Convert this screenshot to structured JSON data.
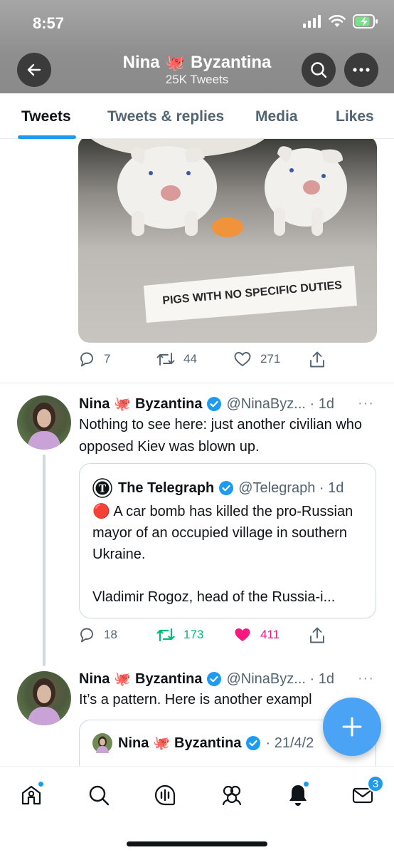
{
  "status_bar": {
    "time": "8:57"
  },
  "header": {
    "name_part1": "Nina",
    "name_emoji": "🐙",
    "name_part2": "Byzantina",
    "tweet_count": "25K Tweets"
  },
  "tabs": [
    {
      "label": "Tweets"
    },
    {
      "label": "Tweets & replies"
    },
    {
      "label": "Media"
    },
    {
      "label": "Likes"
    }
  ],
  "tweet1": {
    "image_sign": "PIGS WITH NO SPECIFIC DUTIES",
    "replies": "7",
    "retweets": "44",
    "likes": "271"
  },
  "tweet2": {
    "name_part1": "Nina",
    "name_emoji": "🐙",
    "name_part2": "Byzantina",
    "handle_time": "@NinaByz... · 1d",
    "more": "···",
    "text": "Nothing to see here: just another civilian who opposed Kiev was blown up.",
    "quote": {
      "name": "The Telegraph",
      "handle_time": "@Telegraph · 1d",
      "text_line1": "🔴 A car bomb has killed the pro-Russian mayor of an occupied village in southern Ukraine.",
      "text_line2": "Vladimir Rogoz, head of the Russia-i..."
    },
    "replies": "18",
    "retweets": "173",
    "likes": "411",
    "liked_color": "#f91880",
    "retweet_color": "#00ba7c"
  },
  "tweet3": {
    "name_part1": "Nina",
    "name_emoji": "🐙",
    "name_part2": "Byzantina",
    "handle_time": "@NinaByz... · 1d",
    "more": "···",
    "text": "It’s a pattern. Here is another exampl",
    "quote": {
      "name_part1": "Nina",
      "name_emoji": "🐙",
      "name_part2": "Byzantina",
      "handle_time": "· 21/4/2"
    }
  },
  "fab": {
    "icon": "plus-icon"
  },
  "bottom_nav": {
    "items": [
      {
        "icon": "home-icon"
      },
      {
        "icon": "search-icon"
      },
      {
        "icon": "spaces-icon"
      },
      {
        "icon": "communities-icon"
      },
      {
        "icon": "notifications-icon"
      },
      {
        "icon": "messages-icon"
      }
    ],
    "messages_badge": "3"
  },
  "colors": {
    "accent": "#1d9bf0",
    "text_secondary": "#536471"
  }
}
